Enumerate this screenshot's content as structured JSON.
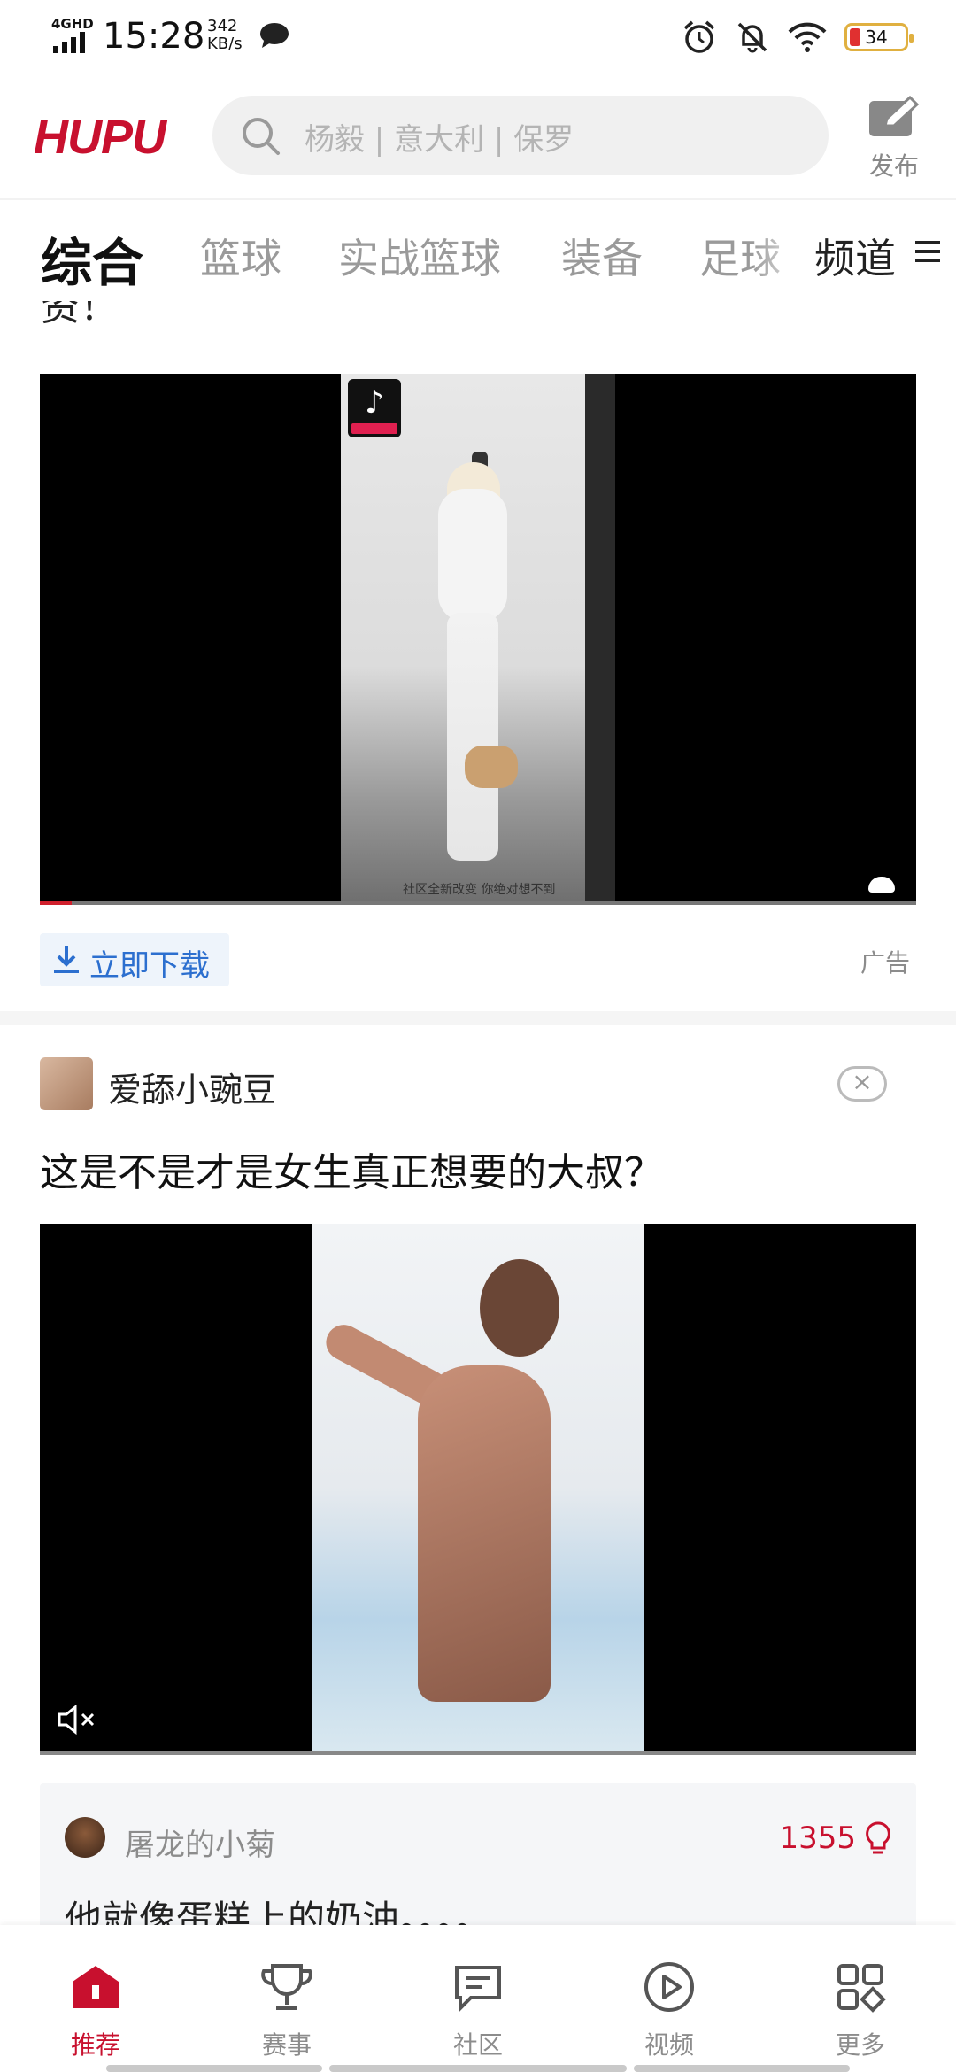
{
  "status_bar": {
    "network": "4GHD",
    "time": "15:28",
    "speed_value": "342",
    "speed_unit": "KB/s",
    "battery": "34"
  },
  "header": {
    "logo": "HUPU",
    "search_placeholder": "杨毅 | 意大利 | 保罗",
    "publish_label": "发布"
  },
  "tabs": {
    "items": [
      "综合",
      "篮球",
      "实战篮球",
      "装备",
      "足球"
    ],
    "active": "综合",
    "channel_label": "频道"
  },
  "feed": {
    "partial_text": "资！",
    "ad_post": {
      "video_caption": "社区全新改变 你绝对想不到",
      "download_label": "立即下载",
      "ad_label": "广告"
    },
    "post": {
      "username": "爱舔小豌豆",
      "title": "这是不是才是女生真正想要的大叔？",
      "top_comment": {
        "username": "屠龙的小菊",
        "likes": "1355",
        "text": "他就像蛋糕上的奶油。。。。"
      }
    }
  },
  "bottom_nav": {
    "items": [
      {
        "label": "推荐",
        "icon": "home-icon",
        "active": true
      },
      {
        "label": "赛事",
        "icon": "trophy-icon",
        "active": false
      },
      {
        "label": "社区",
        "icon": "community-icon",
        "active": false
      },
      {
        "label": "视频",
        "icon": "video-play-icon",
        "active": false
      },
      {
        "label": "更多",
        "icon": "more-grid-icon",
        "active": false
      }
    ]
  },
  "colors": {
    "brand_red": "#c8102e",
    "link_blue": "#2c6fcf"
  }
}
